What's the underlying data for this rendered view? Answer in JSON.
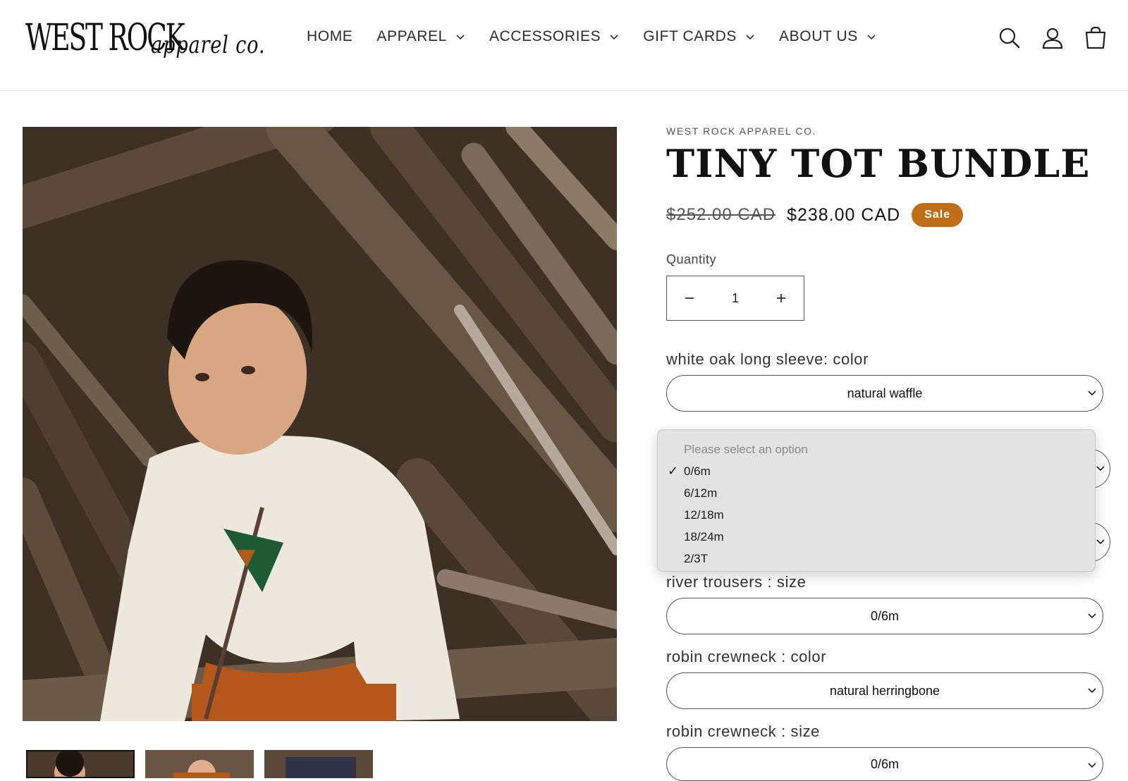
{
  "header": {
    "logo_line1": "WEST ROCK",
    "logo_line2": "apparel co.",
    "nav": [
      {
        "label": "HOME",
        "dropdown": false
      },
      {
        "label": "APPAREL",
        "dropdown": true
      },
      {
        "label": "ACCESSORIES",
        "dropdown": true
      },
      {
        "label": "GIFT CARDS",
        "dropdown": true
      },
      {
        "label": "ABOUT US",
        "dropdown": true
      }
    ],
    "icons": [
      "search-icon",
      "account-icon",
      "cart-icon"
    ]
  },
  "product": {
    "vendor": "WEST ROCK APPAREL CO.",
    "title": "TINY TOT BUNDLE",
    "price_old": "$252.00 CAD",
    "price_new": "$238.00 CAD",
    "badge": "Sale",
    "quantity_label": "Quantity",
    "quantity": "1",
    "options": [
      {
        "label": "white oak long sleeve: color",
        "value": "natural waffle"
      },
      {
        "label": "",
        "value": ""
      },
      {
        "label": "",
        "value": ""
      },
      {
        "label": "river trousers : size",
        "value": "0/6m"
      },
      {
        "label": "robin crewneck : color",
        "value": "natural herringbone"
      },
      {
        "label": "robin crewneck : size",
        "value": "0/6m"
      }
    ]
  },
  "dropdown": {
    "placeholder": "Please select an option",
    "selected": "0/6m",
    "items": [
      "0/6m",
      "6/12m",
      "12/18m",
      "18/24m",
      "2/3T"
    ]
  },
  "colors": {
    "badge": "#c06e17",
    "text": "#121212",
    "border": "#555555"
  }
}
